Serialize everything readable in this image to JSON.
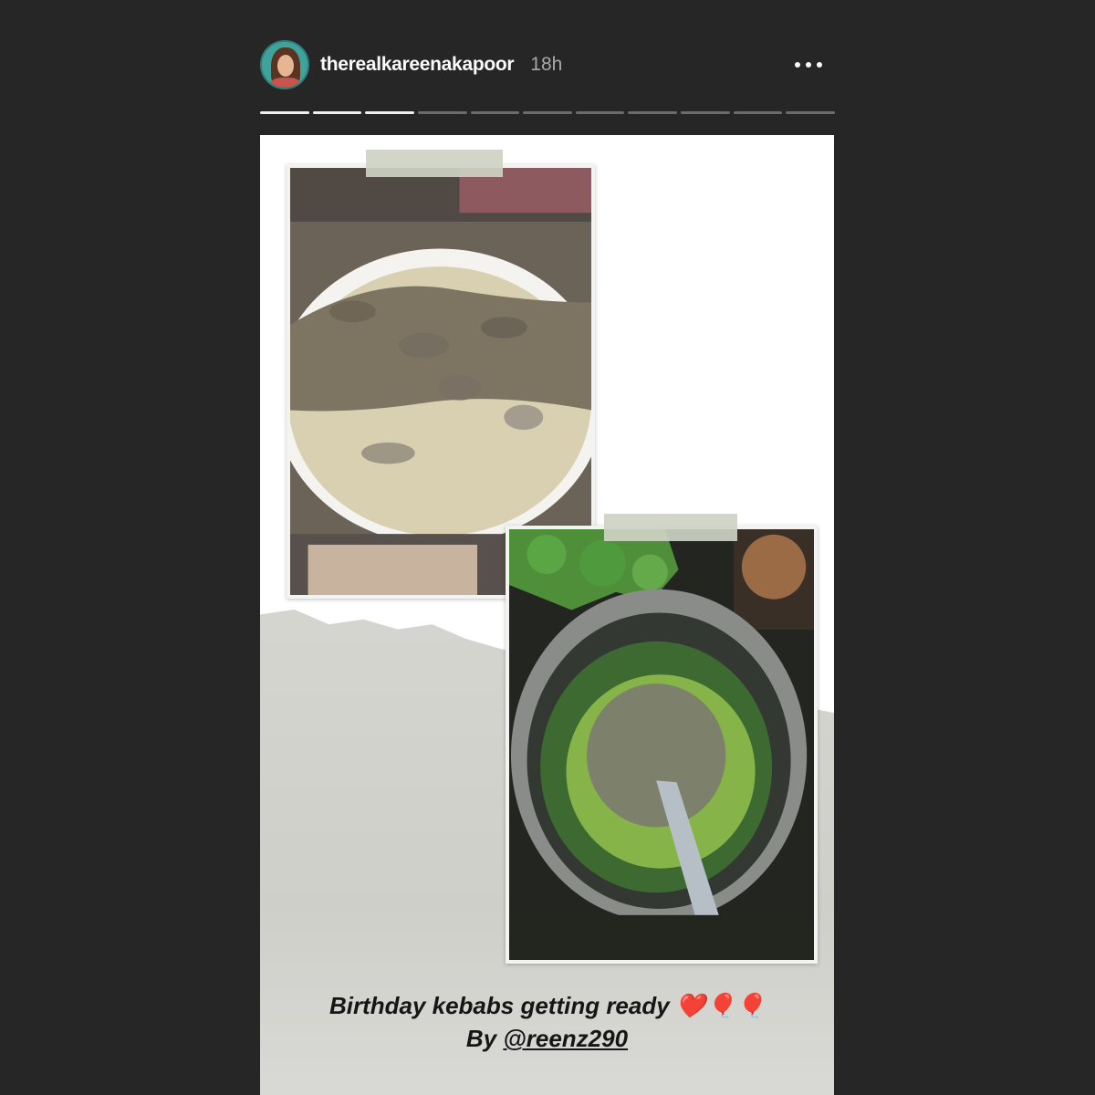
{
  "header": {
    "username": "therealkareenakapoor",
    "time": "18h"
  },
  "progress": {
    "total_segments": 11,
    "completed_segments": 3
  },
  "caption": {
    "line1": "Birthday kebabs getting ready ❤️🎈🎈",
    "by_label": "By",
    "mention": "@reenz290"
  },
  "colors": {
    "background": "#262626",
    "text": "#fafafa",
    "muted": "#a8a8a8"
  }
}
